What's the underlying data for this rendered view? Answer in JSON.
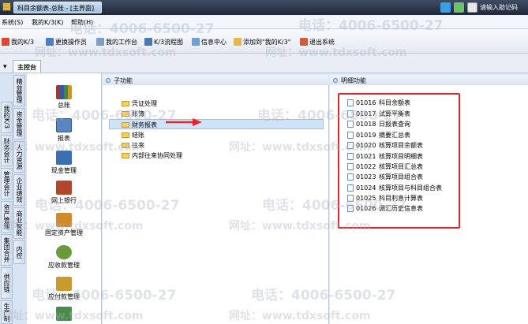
{
  "window": {
    "title": "科目余额表-总账 - [主界面]"
  },
  "titlebar": {
    "login_text": "请输入助记码"
  },
  "menu": {
    "items": [
      "系统(S)",
      "我的K/3(K)",
      "帮助(H)"
    ]
  },
  "toolbar": {
    "items": [
      "我的K/3",
      "更换操作员",
      "我的工作台",
      "K/3流程图",
      "信息中心",
      "添加到\"我的K/3\"",
      "退出系统"
    ]
  },
  "tabs": {
    "arrow": "▾",
    "main": "主控台"
  },
  "left_tabs": [
    "我的K/3",
    "财务会计",
    "管理会计",
    "资产管理",
    "集团合并",
    "供应链",
    "生产制造",
    "精益管理",
    "资金管理",
    "人力资源",
    "企业绩效",
    "商业智能",
    "内控"
  ],
  "modules": [
    "总账",
    "报表",
    "现金管理",
    "网上银行",
    "固定资产管理",
    "应收款管理",
    "应付款管理"
  ],
  "sub_panel": {
    "title": "子功能",
    "items": [
      "凭证处理",
      "账簿",
      "财务报表",
      "结账",
      "往来",
      "内部往来协同处理"
    ],
    "selected": 2
  },
  "detail_panel": {
    "title": "明细功能",
    "items": [
      {
        "code": "01016",
        "name": "科目余额表"
      },
      {
        "code": "01017",
        "name": "试算平衡表"
      },
      {
        "code": "01018",
        "name": "日报表查询"
      },
      {
        "code": "01019",
        "name": "摘要汇总表"
      },
      {
        "code": "01020",
        "name": "核算项目余额表"
      },
      {
        "code": "01021",
        "name": "核算项目明细表"
      },
      {
        "code": "01022",
        "name": "核算项目汇总表"
      },
      {
        "code": "01023",
        "name": "核算项目组合表"
      },
      {
        "code": "01024",
        "name": "核算项目与科目组合表"
      },
      {
        "code": "01025",
        "name": "科目利息计算表"
      },
      {
        "code": "01026",
        "name": "调汇历史信息表"
      }
    ]
  },
  "watermark": {
    "tel": "电话：4006-6500-27",
    "site": "网址：www.tdxsoft.com"
  },
  "colors": {
    "highlight_box": "#e0252b",
    "arrow": "#e0252b"
  }
}
